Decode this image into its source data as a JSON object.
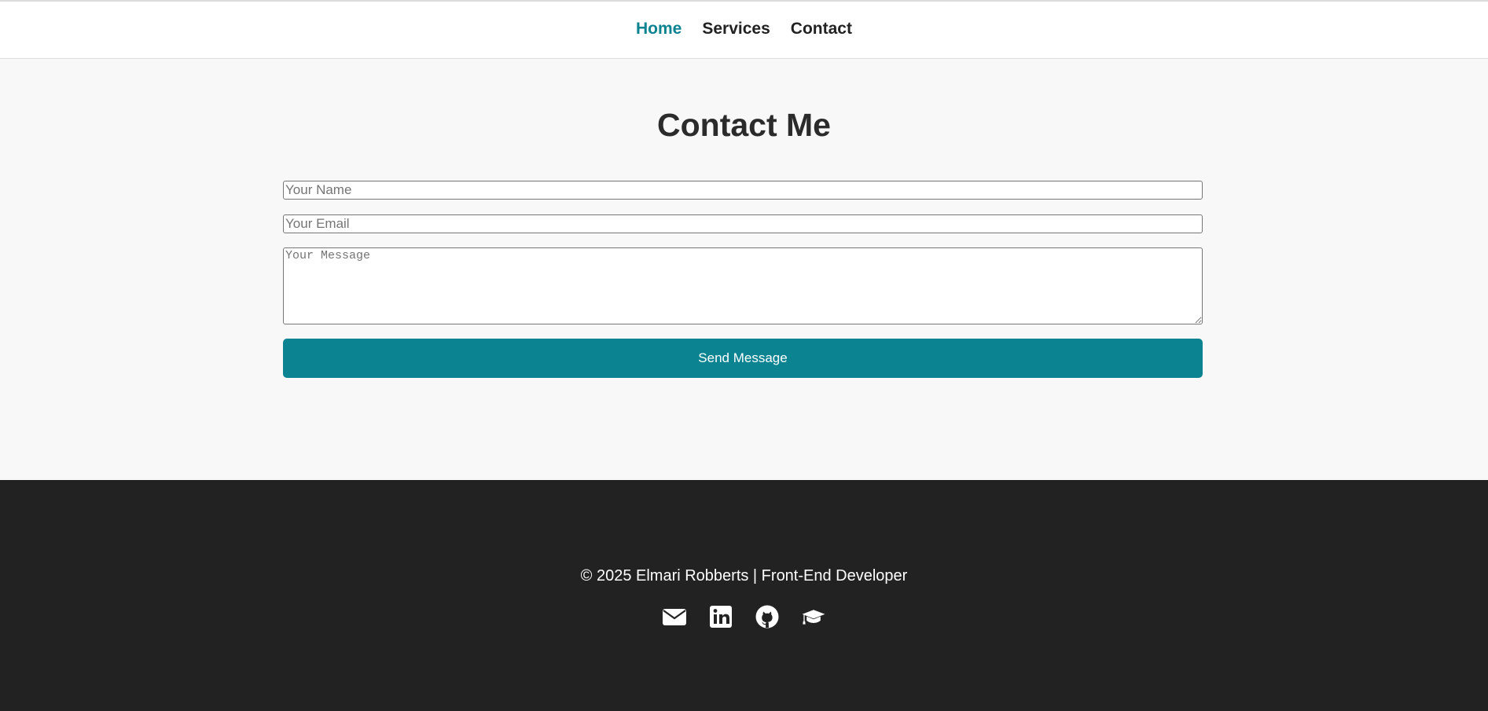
{
  "nav": {
    "items": [
      {
        "label": "Home",
        "active": true
      },
      {
        "label": "Services",
        "active": false
      },
      {
        "label": "Contact",
        "active": false
      }
    ]
  },
  "contact": {
    "title": "Contact Me",
    "name_placeholder": "Your Name",
    "email_placeholder": "Your Email",
    "message_placeholder": "Your Message",
    "submit_label": "Send Message"
  },
  "footer": {
    "copyright": "© 2025 Elmari Robberts | Front-End Developer",
    "icons": [
      "envelope-icon",
      "linkedin-icon",
      "github-icon",
      "graduation-cap-icon"
    ]
  },
  "colors": {
    "accent": "#0b8391",
    "footer_bg": "#222222",
    "main_bg": "#f8f8f8"
  }
}
